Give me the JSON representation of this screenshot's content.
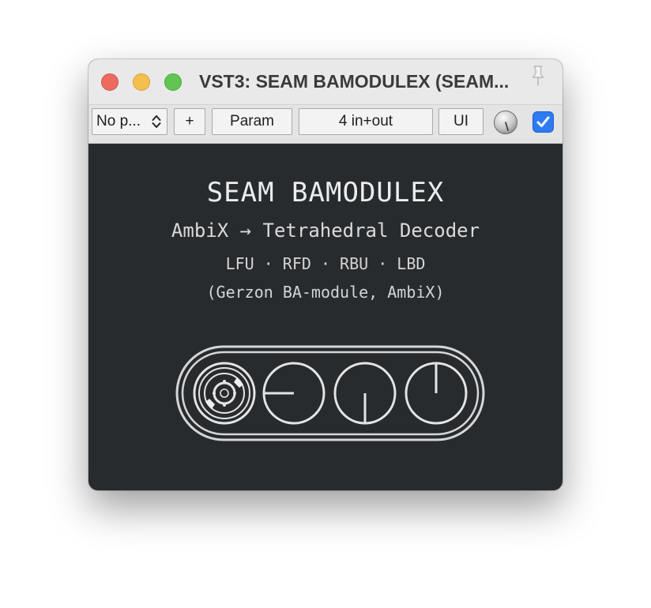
{
  "window": {
    "title": "VST3: SEAM BAMODULEX (SEAM..."
  },
  "toolbar": {
    "preset_label": "No p...",
    "add_label": "+",
    "param_label": "Param",
    "io_label": "4 in+out",
    "ui_label": "UI"
  },
  "plugin": {
    "heading": "SEAM BAMODULEX",
    "subtitle": "AmbiX → Tetrahedral Decoder",
    "channels": "LFU · RFD · RBU · LBD",
    "note": "(Gerzon BA-module, AmbiX)"
  },
  "icons": {
    "close": "close-traffic-light-icon",
    "minimize": "minimize-traffic-light-icon",
    "maximize": "maximize-traffic-light-icon",
    "pin": "pin-icon",
    "stepper": "up-down-chevron-icon",
    "knob": "knob-icon",
    "checkbox": "checkmark-icon",
    "logo": "plugin-logo-icon"
  },
  "colors": {
    "background": "#282b2e",
    "text": "#e6e6e6",
    "checkbox": "#2d7bf2",
    "close": "#ed6a5e",
    "minimize": "#f5bf4f",
    "maximize": "#61c554"
  }
}
